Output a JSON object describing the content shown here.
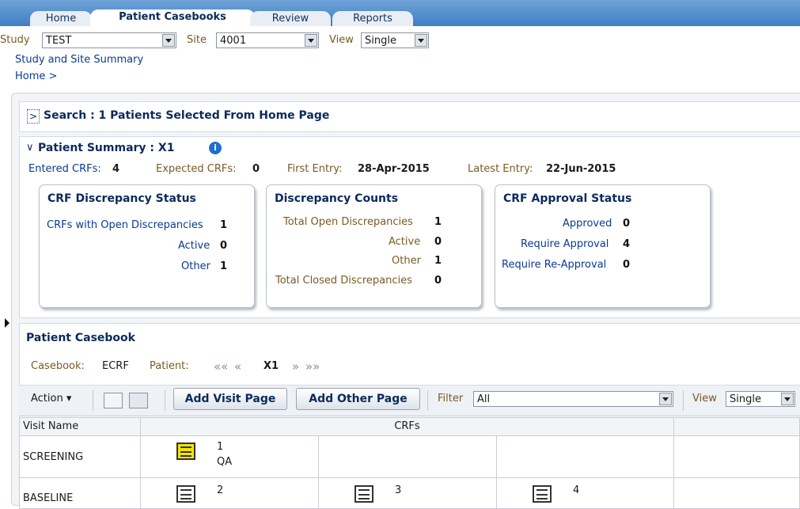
{
  "tabs": [
    {
      "label": "Home",
      "active": false
    },
    {
      "label": "Patient Casebooks",
      "active": true
    },
    {
      "label": "Review",
      "active": false
    },
    {
      "label": "Reports",
      "active": false
    }
  ],
  "context": {
    "study_label": "Study",
    "study_value": "TEST",
    "site_label": "Site",
    "site_value": "4001",
    "view_label": "View",
    "view_value": "Single"
  },
  "nav": {
    "summary_link": "Study and Site Summary",
    "breadcrumb": "Home >"
  },
  "search": {
    "toggle": ">",
    "title": "Search : 1 Patients Selected From Home Page"
  },
  "summary": {
    "toggle": "∨",
    "title": "Patient Summary : X1",
    "info_icon": "i",
    "entered_label": "Entered CRFs:",
    "entered_value": "4",
    "expected_label": "Expected CRFs:",
    "expected_value": "0",
    "first_label": "First Entry:",
    "first_value": "28-Apr-2015",
    "latest_label": "Latest Entry:",
    "latest_value": "22-Jun-2015",
    "boxes": {
      "discrepancy_status": {
        "title": "CRF Discrepancy Status",
        "open_label": "CRFs with Open Discrepancies",
        "open_value": "1",
        "active_label": "Active",
        "active_value": "0",
        "other_label": "Other",
        "other_value": "1"
      },
      "discrepancy_counts": {
        "title": "Discrepancy Counts",
        "total_open_label": "Total Open Discrepancies",
        "total_open_value": "1",
        "active_label": "Active",
        "active_value": "0",
        "other_label": "Other",
        "other_value": "1",
        "total_closed_label": "Total Closed Discrepancies",
        "total_closed_value": "0"
      },
      "approval_status": {
        "title": "CRF Approval Status",
        "approved_label": "Approved",
        "approved_value": "0",
        "require_label": "Require Approval",
        "require_value": "4",
        "reapproval_label": "Require Re-Approval",
        "reapproval_value": "0"
      }
    }
  },
  "casebook": {
    "title": "Patient Casebook",
    "casebook_label": "Casebook:",
    "casebook_value": "ECRF",
    "patient_label": "Patient:",
    "patient_value": "X1",
    "first_icon": "««",
    "prev_icon": "«",
    "next_icon": "»",
    "last_icon": "»»",
    "action_label": "Action ▾",
    "add_visit_label": "Add Visit Page",
    "add_other_label": "Add Other Page",
    "filter_label": "Filter",
    "filter_value": "All",
    "view_label": "View",
    "view_value": "Single",
    "columns": [
      "Visit Name",
      "CRFs"
    ],
    "rows": [
      {
        "visit": "SCREENING",
        "crfs": [
          {
            "num": "1",
            "sub": "QA"
          }
        ]
      },
      {
        "visit": "BASELINE",
        "crfs": [
          {
            "num": "2",
            "sub": ""
          },
          {
            "num": "3",
            "sub": ""
          },
          {
            "num": "4",
            "sub": ""
          }
        ]
      }
    ]
  }
}
